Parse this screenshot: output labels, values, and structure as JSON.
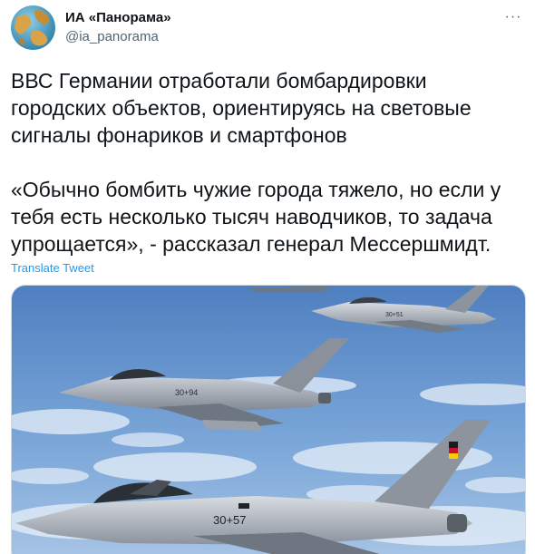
{
  "author": {
    "display_name": "ИА «Панорама»",
    "handle": "@ia_panorama",
    "avatar_icon": "globe-avatar-icon"
  },
  "menu": {
    "more_icon": "more-horizontal-icon",
    "more_label": "···"
  },
  "tweet": {
    "text": "ВВС Германии отработали бомбардировки городских объектов, ориентируясь на световые сигналы фонариков и смартфонов\n\n«Обычно бомбить чужие города тяжело, но если у тебя есть несколько тысяч наводчиков, то задача упрощается», - рассказал генерал Мессершмидт.",
    "translate_label": "Translate Tweet"
  },
  "media": {
    "description_icon": "fighter-jets-photo",
    "jet_markings": [
      "30+94",
      "30+57"
    ]
  },
  "colors": {
    "text": "#0f1419",
    "secondary": "#536471",
    "link": "#1d9bf0",
    "sky": "#5a86c2"
  }
}
